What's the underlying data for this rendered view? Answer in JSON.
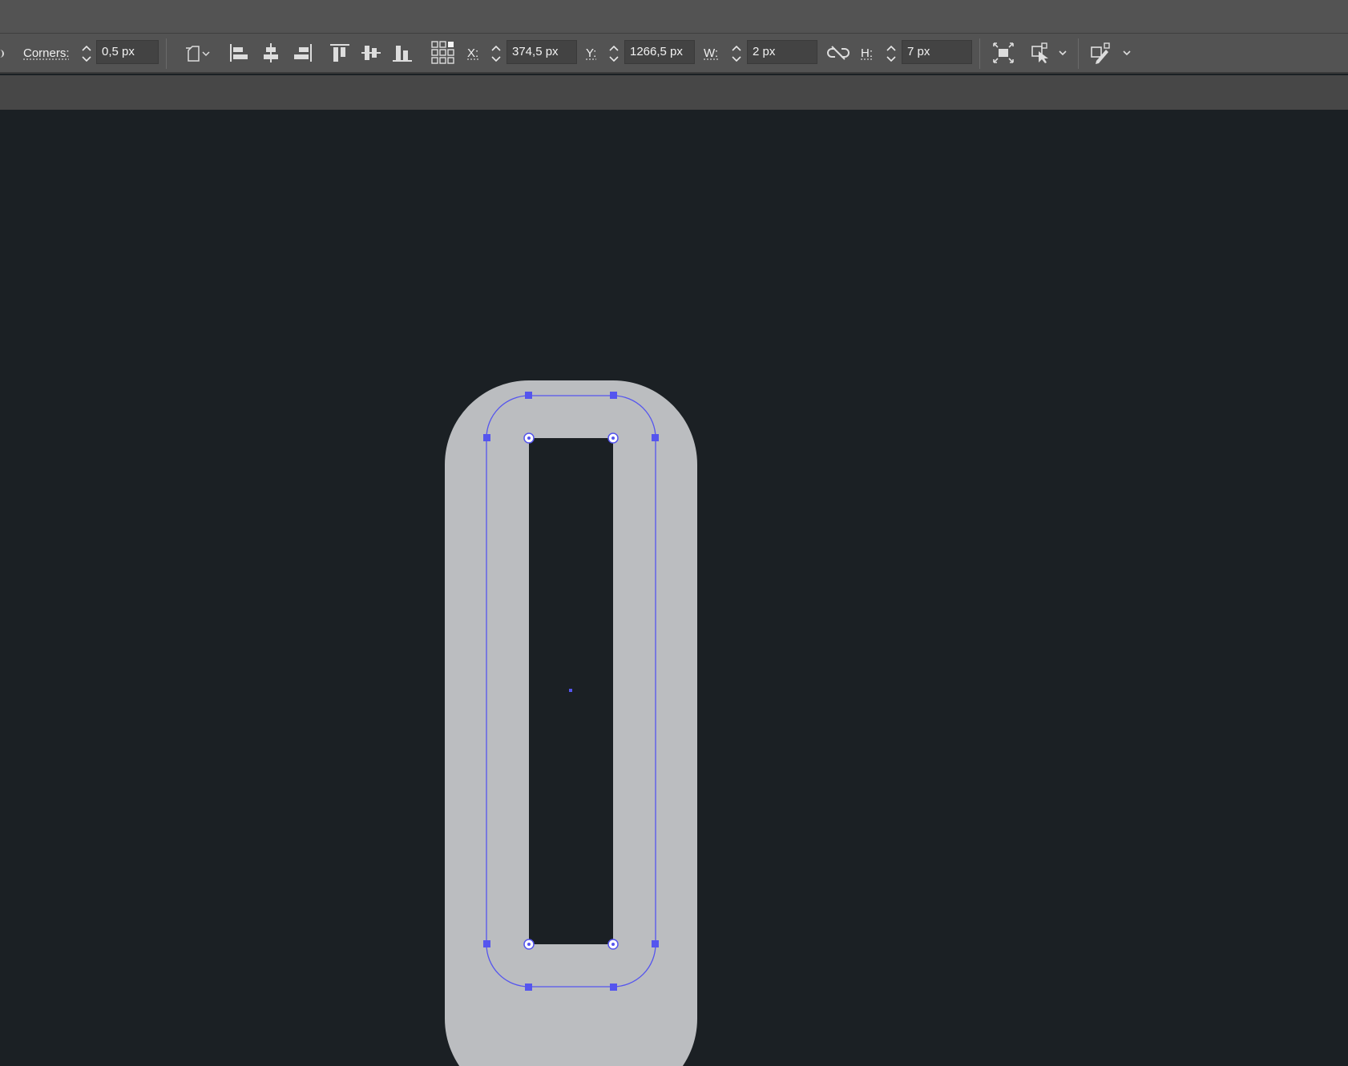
{
  "control_bar": {
    "corners": {
      "label": "Corners:",
      "value": "0,5 px"
    },
    "x": {
      "label": "X:",
      "value": "374,5 px"
    },
    "y": {
      "label": "Y:",
      "value": "1266,5 px"
    },
    "w": {
      "label": "W:",
      "value": "2 px"
    },
    "h": {
      "label": "H:",
      "value": "7 px"
    }
  },
  "icons": [
    "corner-type-dropdown-icon",
    "align-left-icon",
    "align-horizontal-center-icon",
    "align-right-icon",
    "align-top-icon",
    "align-vertical-center-icon",
    "align-bottom-icon",
    "reference-point-grid-icon",
    "link-proportions-icon",
    "transform-bounding-box-icon",
    "transform-options-icon",
    "edit-path-options-icon"
  ],
  "colors": {
    "toolbar_bg": "#535353",
    "sub_bar_bg": "#474747",
    "canvas_bg": "#1b2024",
    "shape_fill": "#bbbdc0",
    "selection": "#5555ee"
  }
}
